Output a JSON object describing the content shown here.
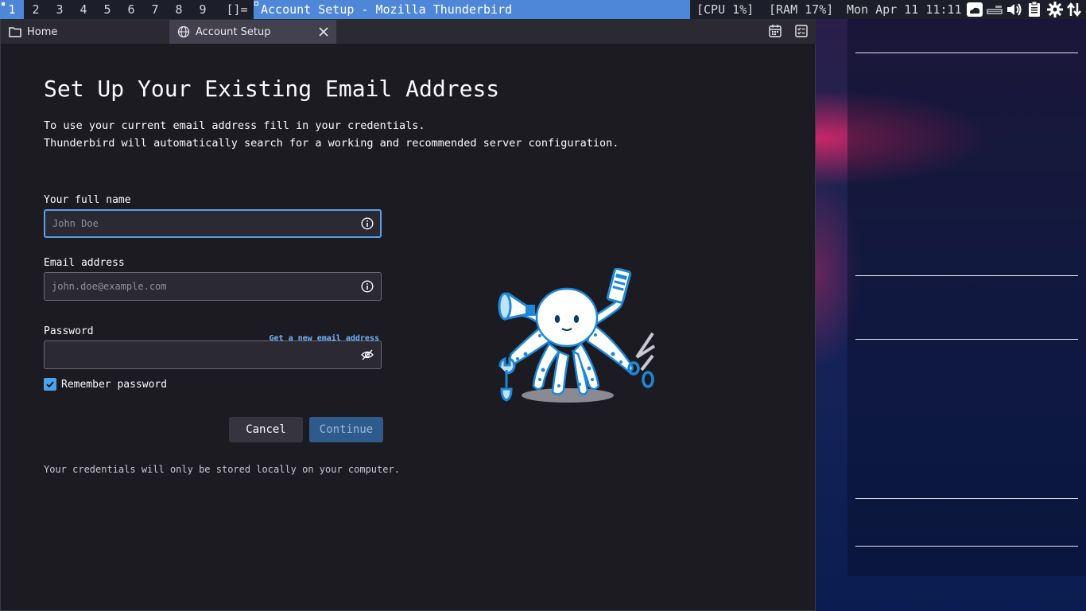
{
  "statusbar": {
    "workspaces": [
      "1",
      "2",
      "3",
      "4",
      "5",
      "6",
      "7",
      "8",
      "9"
    ],
    "active_workspace": "1",
    "layout_symbol": "[]=",
    "window_title": "Account Setup - Mozilla Thunderbird",
    "cpu": "[CPU 1%]",
    "ram": "[RAM 17%]",
    "datetime": "Mon Apr 11 11:11",
    "tray_icons": [
      "cloud-icon",
      "keyboard-icon",
      "volume-icon",
      "clipboard-icon",
      "gear-icon",
      "network-arrows-icon"
    ],
    "accent": "#4f87d8"
  },
  "tabs": [
    {
      "label": "Home",
      "icon": "folder-icon"
    },
    {
      "label": "Account Setup",
      "icon": "globe-icon",
      "active": true
    }
  ],
  "toolbar_icons": [
    "calendar-icon",
    "tasks-icon"
  ],
  "setup": {
    "title": "Set Up Your Existing Email Address",
    "intro_line1": "To use your current email address fill in your credentials.",
    "intro_line2": "Thunderbird will automatically search for a working and recommended server configuration.",
    "name_label": "Your full name",
    "name_placeholder": "John Doe",
    "email_label": "Email address",
    "email_placeholder": "john.doe@example.com",
    "get_new_email": "Get a new email address",
    "password_label": "Password",
    "password_value": "",
    "remember_label": "Remember password",
    "remember_checked": true,
    "cancel": "Cancel",
    "continue": "Continue",
    "footnote": "Your credentials will only be stored locally on your computer."
  }
}
